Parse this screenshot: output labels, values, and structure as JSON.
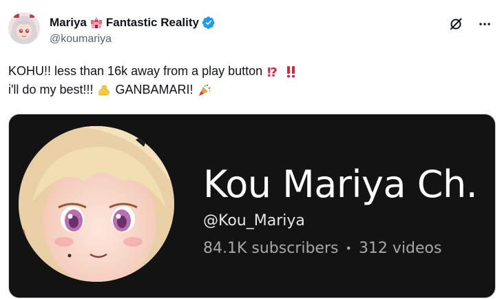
{
  "author": {
    "display_name": "Mariya",
    "display_name_suffix": "Fantastic Reality",
    "handle": "@koumariya",
    "name_emoji": "castle-emoji",
    "verified": true,
    "verified_color": "#1d9bf0"
  },
  "tweet": {
    "line1_text": "KOHU!! less than 16k away from a play button",
    "line1_emojis": [
      "⁉️",
      "‼️"
    ],
    "line2_text": "i'll do my best!!!",
    "line2_emoji_1": "💪",
    "line2_word": "GANBAMARI!",
    "line2_emoji_2": "🎉"
  },
  "media": {
    "channel_name": "Kou Mariya Ch.",
    "channel_handle": "@Kou_Mariya",
    "subscribers": "84.1K subscribers",
    "separator": "•",
    "videos": "312 videos",
    "background_color": "#131313"
  },
  "icons": {
    "grok": "grok-icon",
    "more": "more-options-icon"
  }
}
